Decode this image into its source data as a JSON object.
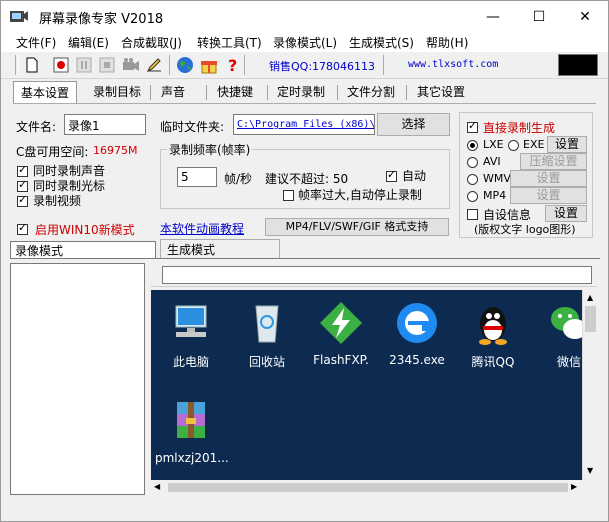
{
  "window": {
    "title": "屏幕录像专家 V2018"
  },
  "titlebar_buttons": {
    "minimize": "—",
    "maximize": "☐",
    "close": "✕"
  },
  "menu": [
    "文件(F)",
    "编辑(E)",
    "合成截取(J)",
    "转换工具(T)",
    "录像模式(L)",
    "生成模式(S)",
    "帮助(H)"
  ],
  "toolbar": {
    "qq_text": "销售QQ:178046113",
    "website": "www.tlxsoft.com"
  },
  "tabs": [
    "基本设置",
    "录制目标",
    "声音",
    "快捷键",
    "定时录制",
    "文件分割",
    "其它设置"
  ],
  "basic": {
    "filename_label": "文件名:",
    "filename_value": "录像1",
    "tempdir_label": "临时文件夹:",
    "tempdir_value": "C:\\Program Files (x86)\\",
    "browse_btn": "选择",
    "disk_space_label": "C盘可用空间:",
    "disk_space_value": "16975M",
    "chk_record_sound": "同时录制声音",
    "chk_record_cursor": "同时录制光标",
    "chk_record_video": "录制视频",
    "chk_win10": "启用WIN10新模式",
    "framerate_group": "录制频率(帧率)",
    "framerate_value": "5",
    "framerate_unit": "帧/秒",
    "max_label": "建议不超过: 50",
    "chk_auto": "自动",
    "chk_autostop": "帧率过大,自动停止录制",
    "tutorial_link": "本软件动画教程",
    "format_btn": "MP4/FLV/SWF/GIF  格式支持"
  },
  "generate": {
    "chk_direct": "直接录制生成",
    "lxe": "LXE",
    "exe": "EXE",
    "avi": "AVI",
    "wmv": "WMV",
    "mp4": "MP4",
    "setting": "设置",
    "compress_setting": "压缩设置",
    "chk_custom": "自设信息",
    "copyright": "(版权文字 logo图形)"
  },
  "modes": {
    "record_mode": "录像模式",
    "generate_mode": "生成模式"
  },
  "desktop_icons": [
    {
      "label": "此电脑",
      "icon": "computer-icon"
    },
    {
      "label": "回收站",
      "icon": "recycle-bin-icon"
    },
    {
      "label": "FlashFXP.",
      "icon": "flashfxp-icon"
    },
    {
      "label": "2345.exe",
      "icon": "browser-2345-icon"
    },
    {
      "label": "腾讯QQ",
      "icon": "qq-icon"
    },
    {
      "label": "微信",
      "icon": "wechat-icon"
    },
    {
      "label": "pmlxzj201...",
      "icon": "winrar-icon"
    }
  ],
  "colors": {
    "red": "#cc0000",
    "link_blue": "#0000cc",
    "desktop_bg": "#0d2b50"
  }
}
